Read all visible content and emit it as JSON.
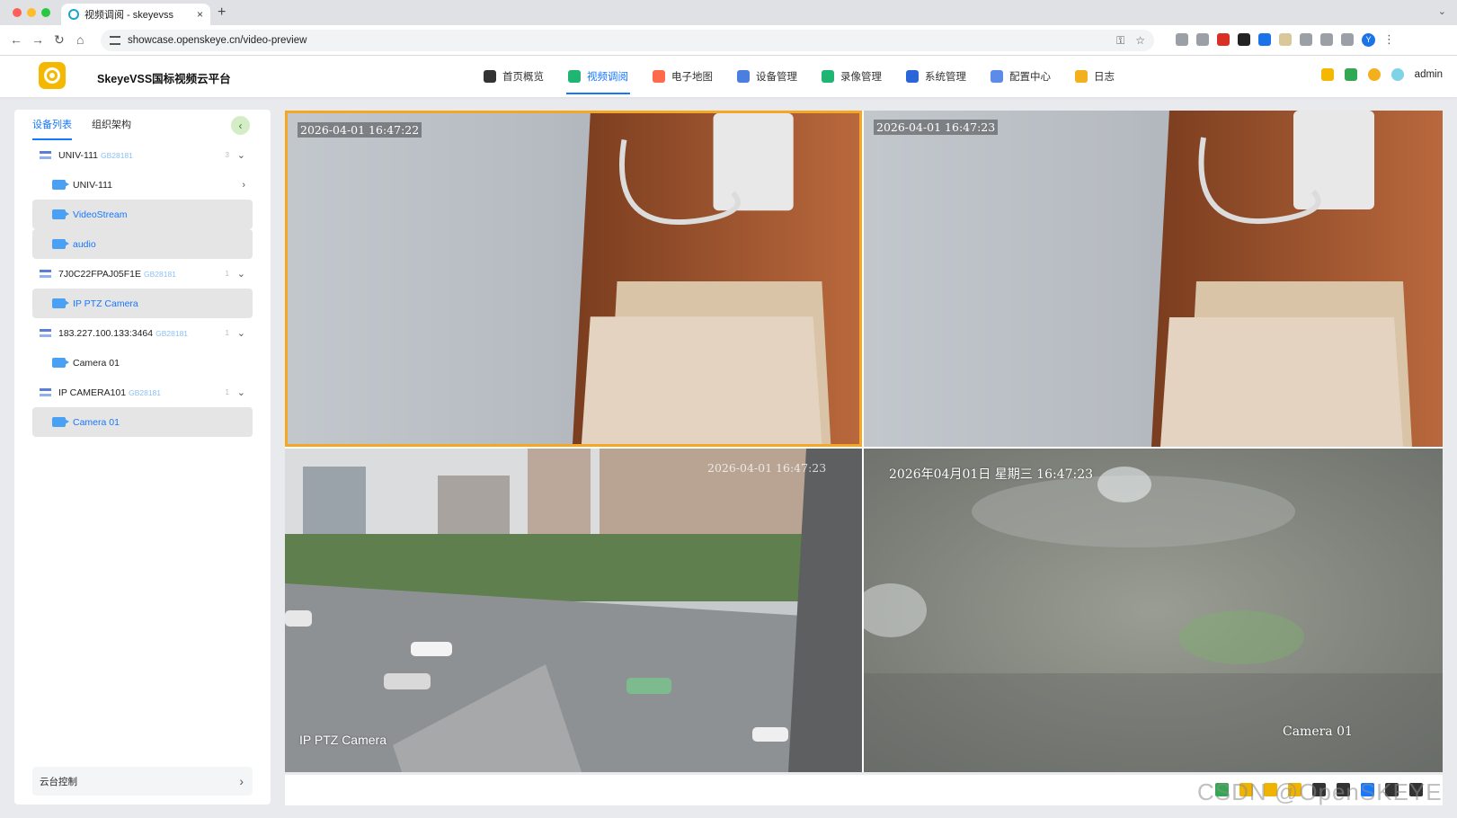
{
  "browser": {
    "tab_title": "视频调阅 - skeyevss",
    "tab_close": "×",
    "new_tab": "+",
    "url": "showcase.openskeye.cn/video-preview",
    "profile_initial": "Y"
  },
  "app": {
    "title": "SkeyeVSS国标视频云平台",
    "nav": [
      {
        "label": "首页概览",
        "icon": "home-icon",
        "color": "#333333"
      },
      {
        "label": "视频调阅",
        "icon": "video-icon",
        "color": "#21b573",
        "active": true
      },
      {
        "label": "电子地图",
        "icon": "map-icon",
        "color": "#ff6a4d"
      },
      {
        "label": "设备管理",
        "icon": "devices-icon",
        "color": "#4a7fe0"
      },
      {
        "label": "录像管理",
        "icon": "recording-icon",
        "color": "#21b573"
      },
      {
        "label": "系统管理",
        "icon": "system-icon",
        "color": "#2a66d9"
      },
      {
        "label": "配置中心",
        "icon": "config-icon",
        "color": "#5d8ce8"
      },
      {
        "label": "日志",
        "icon": "log-icon",
        "color": "#f2b01e"
      }
    ],
    "user": "admin"
  },
  "sidebar": {
    "tabs": [
      "设备列表",
      "组织架构"
    ],
    "devices": [
      {
        "name": "UNIV-111",
        "protocol": "GB28181",
        "count": "3",
        "channels": [
          {
            "name": "UNIV-111",
            "selected": false,
            "has_arrow": true
          },
          {
            "name": "VideoStream",
            "selected": true
          },
          {
            "name": "audio",
            "selected": true
          }
        ]
      },
      {
        "name": "7J0C22FPAJ05F1E",
        "protocol": "GB28181",
        "count": "1",
        "channels": [
          {
            "name": "IP PTZ Camera",
            "selected": true
          }
        ]
      },
      {
        "name": "183.227.100.133:3464",
        "protocol": "GB28181",
        "count": "1",
        "channels": [
          {
            "name": "Camera 01",
            "selected": false
          }
        ]
      },
      {
        "name": "IP CAMERA101",
        "protocol": "GB28181",
        "count": "1",
        "channels": [
          {
            "name": "Camera 01",
            "selected": true
          }
        ]
      }
    ],
    "ptz_label": "云台控制"
  },
  "videos": [
    {
      "timestamp": "2026-04-01  16:47:22",
      "caption": "",
      "active": true
    },
    {
      "timestamp": "2026-04-01  16:47:23",
      "caption": ""
    },
    {
      "timestamp": "2026-04-01  16:47:23",
      "caption": "IP PTZ Camera"
    },
    {
      "timestamp": "2026年04月01日  星期三  16:47:23",
      "caption": "Camera 01"
    }
  ],
  "watermark": "CSDN @OpenSKEYE"
}
